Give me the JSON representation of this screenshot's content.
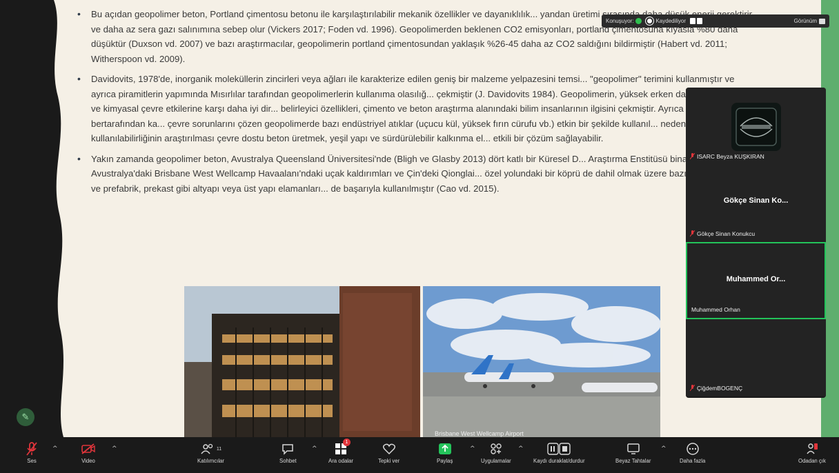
{
  "slide": {
    "bullets": [
      "Bu açıdan geopolimer beton, Portland çimentosu betonu ile karşılaştırılabilir mekanik özellikler ve dayanıklılık... yandan üretimi sırasında daha düşük enerji gerektirir ve daha az sera gazı salınımına sebep olur (Vickers 2017; Foden vd. 1996). Geopolimerden beklenen CO2 emisyonları, portland çimentosuna kıyasla %80 daha düşüktür (Duxson vd. 2007) ve bazı araştırmacılar, geopolimerin portland çimentosundan yaklaşık %26-45 daha az CO2 saldığını bildirmiştir (Habert vd. 2011; Witherspoon vd. 2009).",
      "Davidovits, 1978'de, inorganik moleküllerin zincirleri veya ağları ile karakterize edilen geniş bir malzeme yelpazesini temsi... \"geopolimer\" terimini kullanmıştır ve ayrıca piramitlerin yapımında Mısırlılar tarafından geopolimerlerin kullanıma olasılığ... çekmiştir (J. Davidovits 1984). Geopolimerin, yüksek erken dayanım gelişimi ve kimyasal çevre etkilerine karşı daha iyi dir... belirleyici özellikleri, çimento ve beton araştırma alanındaki bilim insanlarının ilgisini çekmiştir. Ayrıca atık bertarafından ka... çevre sorunlarını çözen geopolimerde bazı endüstriyel atıklar (uçucu kül, yüksek fırın cürufu vb.) etkin bir şekilde kullanıl... nedenle, geopolimerin kullanılabilirliğinin araştırılması çevre dostu beton üretmek, yeşil yapı ve sürdürülebilir kalkınma el... etkili bir çözüm sağlayabilir.",
      "Yakın zamanda geopolimer beton, Avustralya Queensland Üniversitesi'nde (Bligh ve Glasby 2013) dört katlı bir Küresel D... Araştırma Enstitüsü binası, Avustralya'daki Brisbane West Wellcamp Havaalanı'ndaki uçak kaldırımları ve Çin'deki Qionglai... özel yolundaki bir köprü de dahil olmak üzere bazı bina, kaldırım ve prefabrik, prekast gibi altyapı veya üst yapı elamanları... de başarıyla kullanılmıştır (Cao vd. 2015)."
    ],
    "photo_caption": "Brisbane West Wellcamp Airport"
  },
  "top_bar": {
    "speaking_label": "Konuşuyor:",
    "recording_label": "Kaydediliyor",
    "view_label": "Görünüm"
  },
  "participants": [
    {
      "label": "ISARC Beyza KUŞKIRAN",
      "center_name": "",
      "muted": true,
      "active": false,
      "has_avatar": true
    },
    {
      "label": "Gökçe Sinan Konukcu",
      "center_name": "Gökçe Sinan Ko...",
      "muted": true,
      "active": false,
      "has_avatar": false
    },
    {
      "label": "Muhammed Orhan",
      "center_name": "Muhammed Or...",
      "muted": false,
      "active": true,
      "has_avatar": false
    },
    {
      "label": "ÇiğdemBOGENÇ",
      "center_name": "",
      "muted": true,
      "active": false,
      "has_avatar": false
    }
  ],
  "toolbar": {
    "audio": "Ses",
    "video": "Video",
    "participants": "Katılımcılar",
    "participants_count": "11",
    "chat": "Sohbet",
    "breakout": "Ara odalar",
    "breakout_badge": "1",
    "react": "Tepki ver",
    "share": "Paylaş",
    "apps": "Uygulamalar",
    "record": "Kaydı duraklat/durdur",
    "whiteboard": "Beyaz Tahtalar",
    "more": "Daha fazla",
    "leave": "Odadan çık"
  },
  "colors": {
    "accent_green": "#23c35a",
    "slide_bg": "#f5f0e6",
    "strip_green": "#5fae6e",
    "leave_red": "#e0353b"
  }
}
